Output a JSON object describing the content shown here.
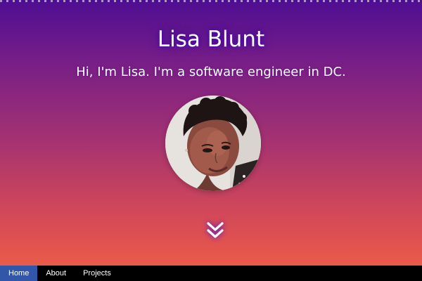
{
  "hero": {
    "name": "Lisa Blunt",
    "tagline": "Hi, I'm Lisa. I'm a software engineer in DC.",
    "avatar_icon": "profile-photo",
    "scroll_icon": "double-chevron-down-icon"
  },
  "nav": {
    "items": [
      {
        "label": "Home",
        "active": true
      },
      {
        "label": "About",
        "active": false
      },
      {
        "label": "Projects",
        "active": false
      }
    ]
  },
  "colors": {
    "gradient_top": "#4e0e92",
    "gradient_bottom": "#ea5a4a",
    "nav_background": "#000000",
    "nav_active": "#3257a8",
    "text": "#ffffff"
  }
}
